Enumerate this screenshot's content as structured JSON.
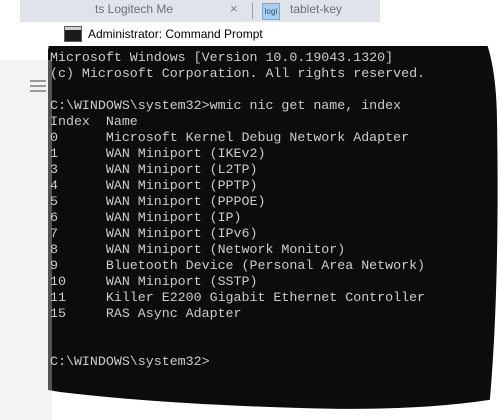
{
  "browser_tabs": {
    "left_tab_label": "ts Logitech Me",
    "left_tab_close": "×",
    "right_tab_favicon_text": "logi",
    "right_tab_label": "tablet-key"
  },
  "console": {
    "title": "Administrator: Command Prompt",
    "lines": [
      "Microsoft Windows [Version 10.0.19043.1320]",
      "(c) Microsoft Corporation. All rights reserved.",
      "",
      "C:\\WINDOWS\\system32>wmic nic get name, index",
      "Index  Name",
      "0      Microsoft Kernel Debug Network Adapter",
      "1      WAN Miniport (IKEv2)",
      "3      WAN Miniport (L2TP)",
      "4      WAN Miniport (PPTP)",
      "5      WAN Miniport (PPPOE)",
      "6      WAN Miniport (IP)",
      "7      WAN Miniport (IPv6)",
      "8      WAN Miniport (Network Monitor)",
      "9      Bluetooth Device (Personal Area Network)",
      "10     WAN Miniport (SSTP)",
      "11     Killer E2200 Gigabit Ethernet Controller",
      "15     RAS Async Adapter",
      "",
      "",
      "C:\\WINDOWS\\system32>"
    ]
  },
  "colors": {
    "console_bg": "#0c0c0c",
    "console_fg": "#cccccc"
  }
}
